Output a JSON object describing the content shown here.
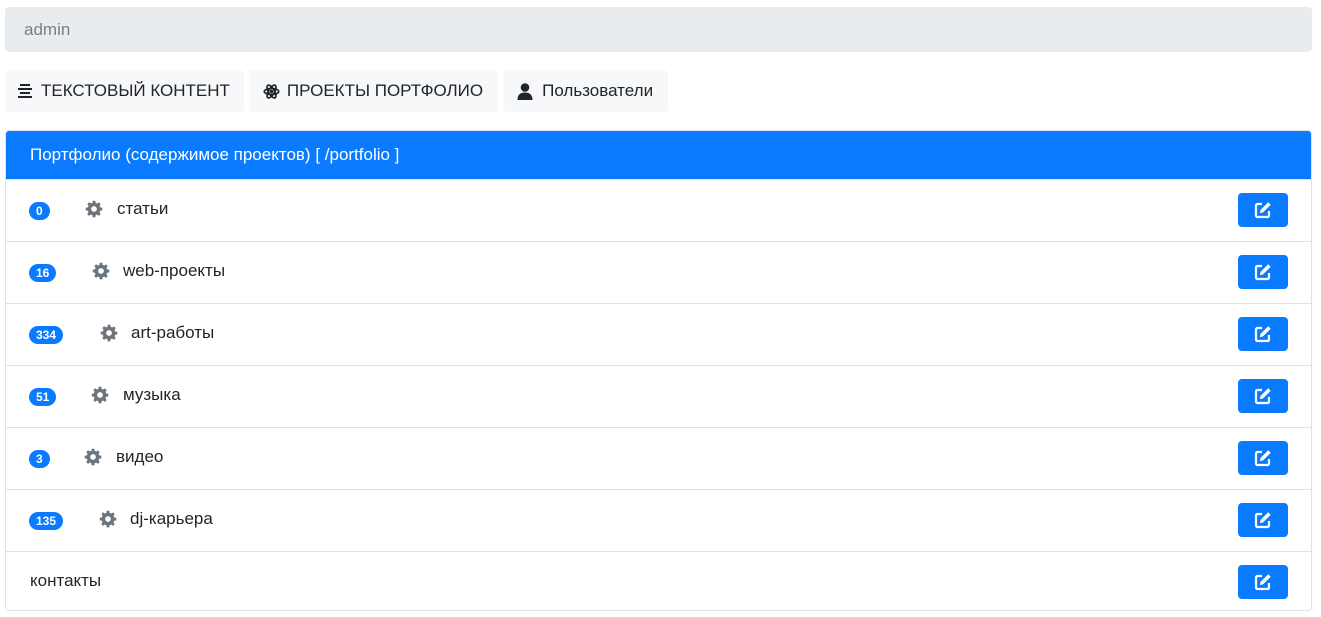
{
  "header": {
    "user": "admin"
  },
  "tabs": [
    {
      "label": "ТЕКСТОВЫЙ КОНТЕНТ",
      "icon": "align-center-icon"
    },
    {
      "label": "ПРОЕКТЫ ПОРТФОЛИО",
      "icon": "atom-icon"
    },
    {
      "label": "Пользователи",
      "icon": "user-icon"
    }
  ],
  "panel": {
    "title": "Портфолио (содержимое проектов) [ /portfolio ]",
    "accent_color": "#0a7bff",
    "rows": [
      {
        "count": "0",
        "label": "статьи"
      },
      {
        "count": "16",
        "label": "web-проекты"
      },
      {
        "count": "334",
        "label": "art-работы"
      },
      {
        "count": "51",
        "label": "музыка"
      },
      {
        "count": "3",
        "label": "видео"
      },
      {
        "count": "135",
        "label": "dj-карьера"
      },
      {
        "label": "контакты"
      }
    ],
    "edit_icon": "edit-icon",
    "row_icon": "gear-icon"
  }
}
